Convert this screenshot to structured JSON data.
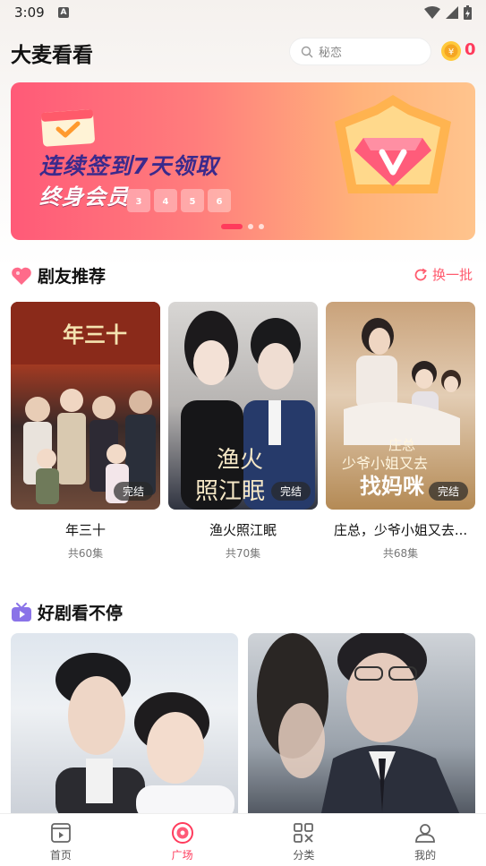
{
  "status_bar": {
    "time": "3:09",
    "notif_icon": "A"
  },
  "header": {
    "title": "大麦看看",
    "search_placeholder": "秘恋",
    "coins": "0"
  },
  "banner": {
    "line1": "连续签到7天领取",
    "line2": "终身会员",
    "days": [
      "3",
      "4",
      "5",
      "6"
    ],
    "slide_count": 3,
    "active_slide": 1
  },
  "section_recommend": {
    "title": "剧友推荐",
    "refresh_label": "换一批",
    "items": [
      {
        "title": "年三十",
        "episodes": "共60集",
        "badge": "完结",
        "poster_text": "年三十"
      },
      {
        "title": "渔火照江眠",
        "episodes": "共70集",
        "badge": "完结",
        "poster_text": "渔火照江眠"
      },
      {
        "title": "庄总，少爷小姐又去...",
        "episodes": "共68集",
        "badge": "完结",
        "poster_text": "庄总 少爷小姐又去找妈咪"
      }
    ]
  },
  "section_nonstop": {
    "title": "好剧看不停"
  },
  "bottom_nav": [
    {
      "label": "首页",
      "icon": "home-play-icon"
    },
    {
      "label": "广场",
      "icon": "disc-icon",
      "active": true
    },
    {
      "label": "分类",
      "icon": "grid-icon"
    },
    {
      "label": "我的",
      "icon": "user-icon"
    }
  ],
  "colors": {
    "accent": "#ff3b5c",
    "refresh": "#ff5b6e"
  }
}
